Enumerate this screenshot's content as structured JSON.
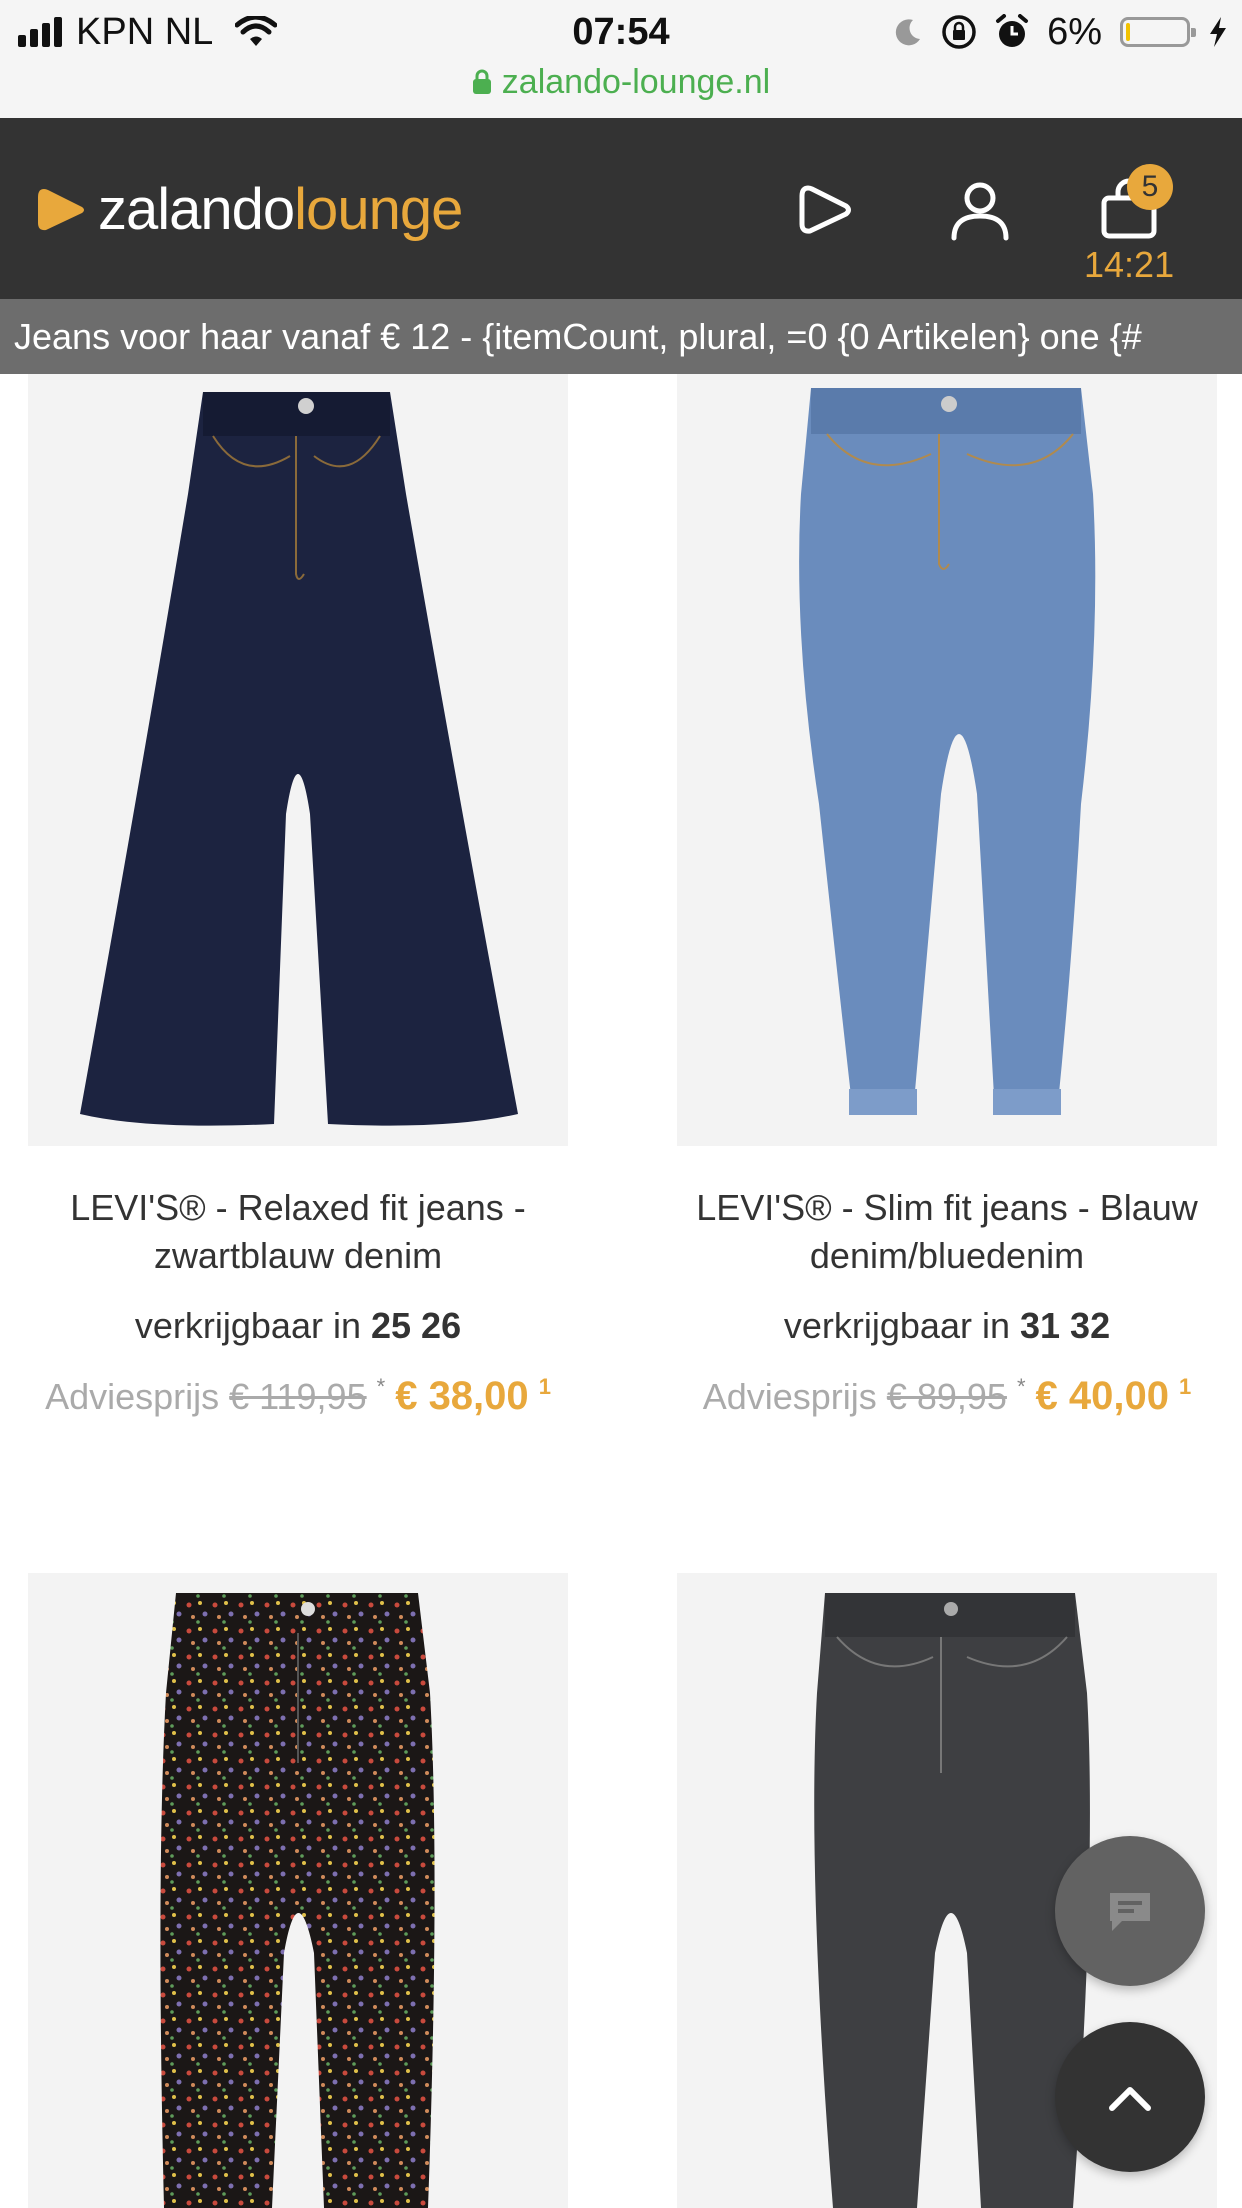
{
  "status_bar": {
    "carrier": "KPN NL",
    "time": "07:54",
    "battery_percent": "6%",
    "battery_level": 0.06,
    "url": "zalando-lounge.nl",
    "icons": [
      "signal-icon",
      "wifi-icon",
      "moon-icon",
      "rotation-lock-icon",
      "alarm-icon",
      "battery-icon",
      "charging-icon",
      "lock-icon"
    ]
  },
  "header": {
    "logo_part1": "zalando",
    "logo_part2": "lounge",
    "cart_count": "5",
    "timer": "14:21",
    "icons": [
      "play-icon",
      "user-icon",
      "shopping-bag-icon"
    ]
  },
  "banner": {
    "text": "Jeans voor haar vanaf € 12  -  {itemCount, plural, =0 {0 Artikelen} one {#"
  },
  "products": [
    {
      "name": "LEVI'S® - Relaxed fit jeans - zwartblauw denim",
      "sizes_prefix": "verkrijgbaar in",
      "sizes": "25 26",
      "price_label": "Adviesprijs",
      "old_price": "€ 119,95",
      "old_price_marker": "*",
      "new_price": "€ 38,00",
      "footnote": "1",
      "image_alt": "wide-leg dark blue jeans"
    },
    {
      "name": "LEVI'S® - Slim fit jeans - Blauw denim/bluedenim",
      "sizes_prefix": "verkrijgbaar in",
      "sizes": "31 32",
      "price_label": "Adviesprijs",
      "old_price": "€ 89,95",
      "old_price_marker": "*",
      "new_price": "€ 40,00",
      "footnote": "1",
      "image_alt": "light blue mom jeans"
    },
    {
      "image_alt": "floral print black jeans"
    },
    {
      "image_alt": "grey washed skinny jeans"
    }
  ],
  "floating_buttons": {
    "chat_icon": "chat-icon",
    "scroll_top_icon": "chevron-up-icon"
  },
  "colors": {
    "accent": "#e8a83c",
    "header_bg": "#333333",
    "banner_bg": "#6d6d6d",
    "url_green": "#4caf50"
  }
}
